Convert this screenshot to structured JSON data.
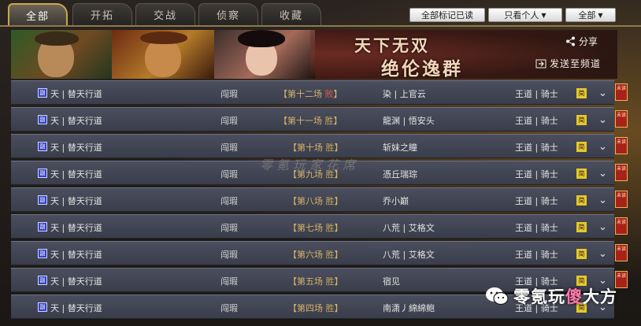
{
  "tabs": [
    {
      "label": "全部",
      "active": true
    },
    {
      "label": "开拓",
      "active": false
    },
    {
      "label": "交战",
      "active": false
    },
    {
      "label": "侦察",
      "active": false
    },
    {
      "label": "收藏",
      "active": false
    }
  ],
  "controls": {
    "mark_all_read": "全部标记已读",
    "filter_value": "只看个人",
    "scope_value": "全部"
  },
  "banner": {
    "slogan_line1": "天下无双",
    "slogan_line2": "绝伦逸群",
    "share_label": "分享",
    "send_video_label": "发送至频道"
  },
  "ribbon_label": "未读",
  "rows": [
    {
      "team_badge": "副",
      "team": "天 | 替天行道",
      "map": "闯瑕",
      "game_open": "【第十二场",
      "result": "败",
      "game_close": "】",
      "opponent": "染 | 上官云",
      "role": "王道 | 骑士",
      "level_badge": "简"
    },
    {
      "team_badge": "副",
      "team": "天 | 替天行道",
      "map": "闯瑕",
      "game_open": "【第十一场",
      "result": "胜",
      "game_close": "】",
      "opponent": "龍渊 | 悟安头",
      "role": "王道 | 骑士",
      "level_badge": "简"
    },
    {
      "team_badge": "副",
      "team": "天 | 替天行道",
      "map": "闯瑕",
      "game_open": "【第十场",
      "result": "胜",
      "game_close": "】",
      "opponent": "斩妹之瞳",
      "role": "王道 | 骑士",
      "level_badge": "简"
    },
    {
      "team_badge": "副",
      "team": "天 | 替天行道",
      "map": "闯瑕",
      "game_open": "【第九场",
      "result": "胜",
      "game_close": "】",
      "opponent": "憑丘瑞琮",
      "role": "王道 | 骑士",
      "level_badge": "简"
    },
    {
      "team_badge": "副",
      "team": "天 | 替天行道",
      "map": "闯瑕",
      "game_open": "【第八场",
      "result": "胜",
      "game_close": "】",
      "opponent": "乔小巅",
      "role": "王道 | 骑士",
      "level_badge": "简"
    },
    {
      "team_badge": "副",
      "team": "天 | 替天行道",
      "map": "闯瑕",
      "game_open": "【第七场",
      "result": "胜",
      "game_close": "】",
      "opponent": "八荒 | 艾格文",
      "role": "王道 | 骑士",
      "level_badge": "简"
    },
    {
      "team_badge": "副",
      "team": "天 | 替天行道",
      "map": "闯瑕",
      "game_open": "【第六场",
      "result": "胜",
      "game_close": "】",
      "opponent": "八荒 | 艾格文",
      "role": "王道 | 骑士",
      "level_badge": "简"
    },
    {
      "team_badge": "副",
      "team": "天 | 替天行道",
      "map": "闯瑕",
      "game_open": "【第五场",
      "result": "胜",
      "game_close": "】",
      "opponent": "宿见",
      "role": "王道 | 骑士",
      "level_badge": "简"
    },
    {
      "team_badge": "副",
      "team": "天 | 替天行道",
      "map": "闯瑕",
      "game_open": "【第四场",
      "result": "胜",
      "game_close": "】",
      "opponent": "南潇丿綿綿鲍",
      "role": "王道 | 骑士",
      "level_badge": "简"
    }
  ],
  "watermark": "零氪玩家花席",
  "wechat_watermark": {
    "prefix": "零氪玩",
    "highlight": "傻",
    "suffix": "大方"
  }
}
